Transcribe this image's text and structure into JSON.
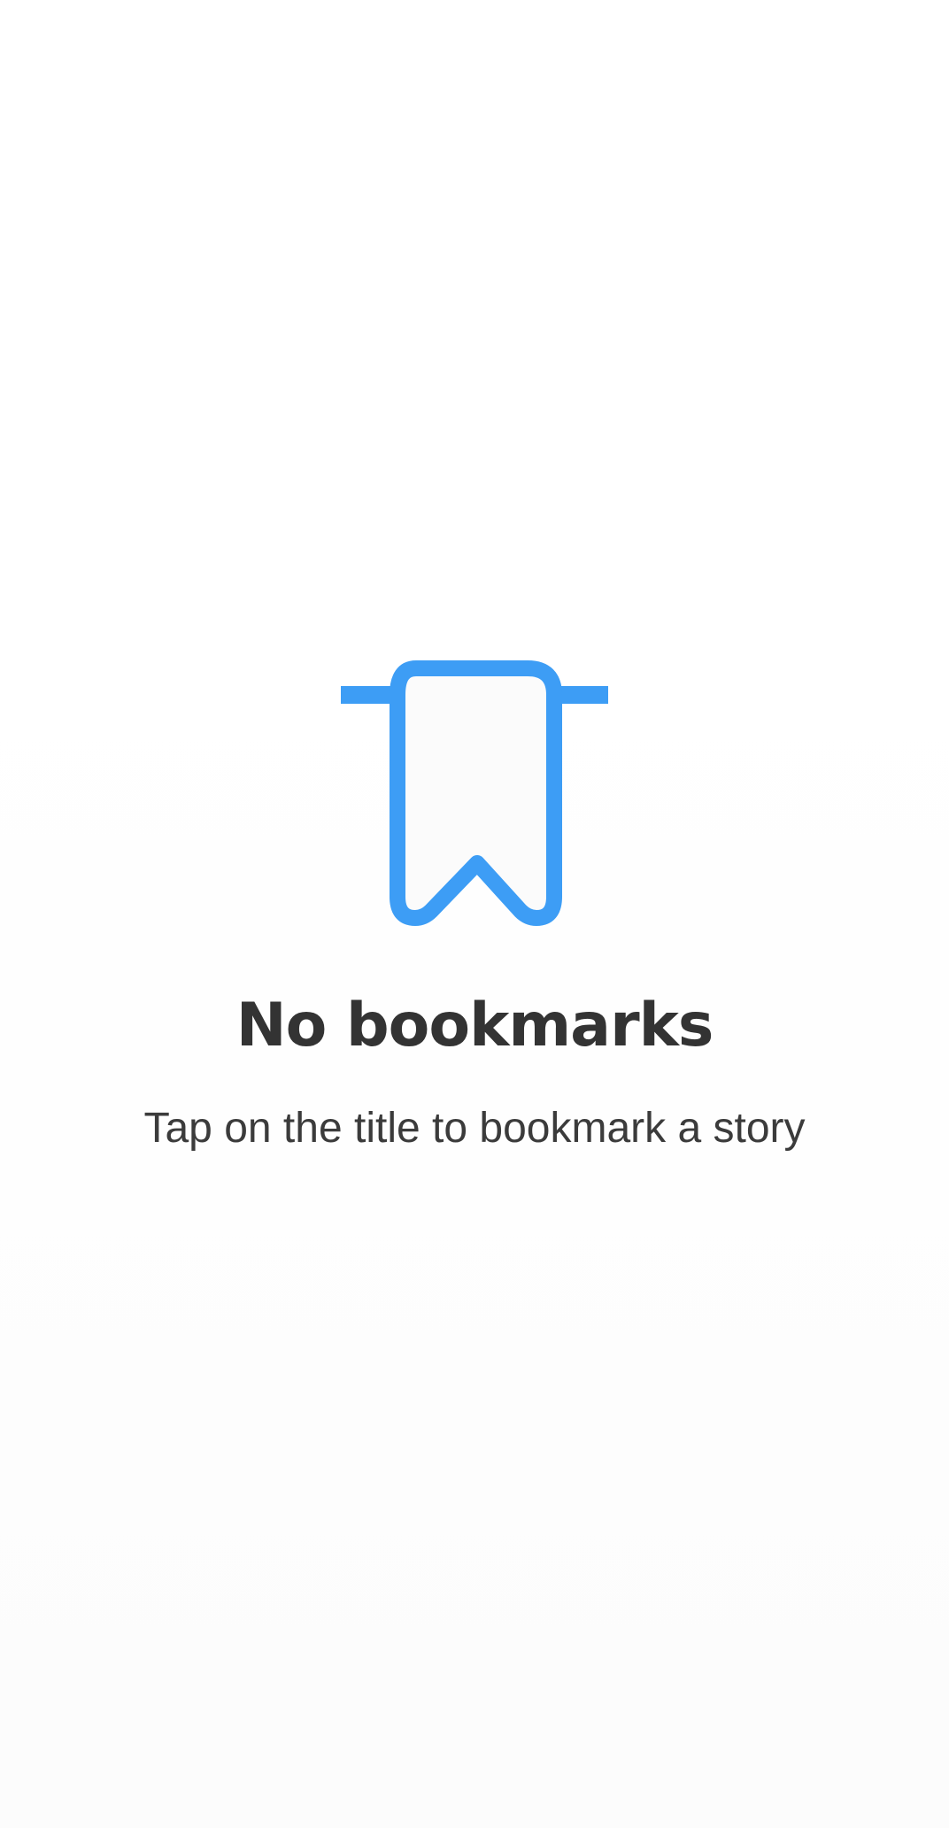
{
  "empty_state": {
    "icon": "bookmark-icon",
    "title": "No bookmarks",
    "subtitle": "Tap on the title to bookmark a story"
  },
  "colors": {
    "accent": "#3d9df5",
    "title_text": "#333333",
    "subtitle_text": "#3b3b3b",
    "background": "#ffffff"
  }
}
